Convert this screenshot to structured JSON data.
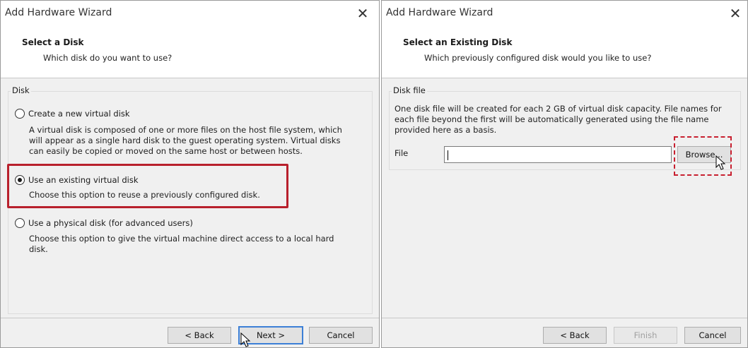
{
  "left_dialog": {
    "title": "Add Hardware Wizard",
    "close_glyph": "✕",
    "header_title": "Select a Disk",
    "header_subtitle": "Which disk do you want to use?",
    "group_label": "Disk",
    "options": [
      {
        "label": "Create a new virtual disk",
        "checked": false,
        "description": [
          "A virtual disk is composed of one or more files on the host file system, which",
          "will appear as a single hard disk to the guest operating system. Virtual disks",
          "can easily be copied or moved on the same host or between hosts."
        ]
      },
      {
        "label": "Use an existing virtual disk",
        "checked": true,
        "description": [
          "Choose this option to reuse a previously configured disk."
        ]
      },
      {
        "label": "Use a physical disk (for advanced users)",
        "checked": false,
        "description": [
          "Choose this option to give the virtual machine direct access to a local hard",
          "disk."
        ]
      }
    ],
    "buttons": {
      "back": "< Back",
      "next": "Next >",
      "cancel": "Cancel"
    }
  },
  "right_dialog": {
    "title": "Add Hardware Wizard",
    "close_glyph": "✕",
    "header_title": "Select an Existing Disk",
    "header_subtitle": "Which previously configured disk would you like to use?",
    "group_label": "Disk file",
    "description": [
      "One disk file will be created for each 2 GB of virtual disk capacity. File names for",
      "each file beyond the first will be automatically generated using the file name",
      "provided here as a basis."
    ],
    "file_label": "File",
    "file_value": "",
    "browse_label": "Browse...",
    "buttons": {
      "back": "< Back",
      "finish": "Finish",
      "cancel": "Cancel"
    }
  },
  "colors": {
    "highlight_solid": "#b8202c",
    "highlight_dashed": "#c82030",
    "default_button_border": "#3c7fd6"
  },
  "icons": [
    "close-icon",
    "mouse-cursor-icon"
  ]
}
